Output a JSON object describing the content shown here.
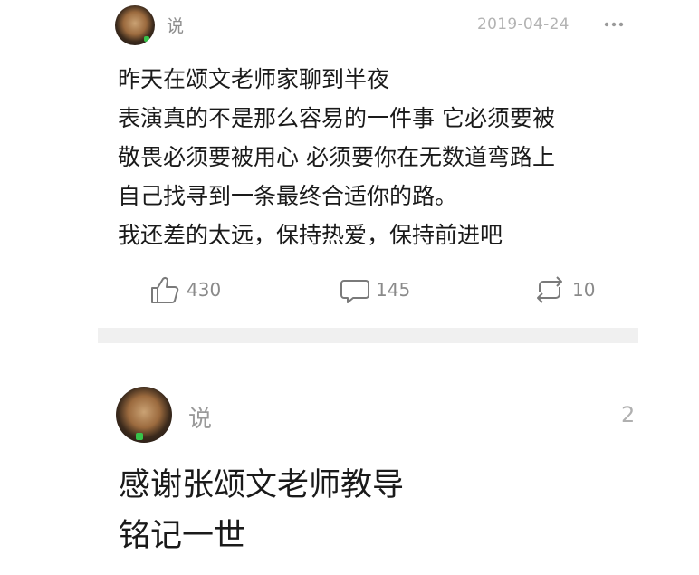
{
  "post1": {
    "author_suffix": "说",
    "date": "2019-04-24",
    "content": [
      "昨天在颂文老师家聊到半夜",
      "表演真的不是那么容易的一件事 它必须要被",
      "敬畏必须要被用心 必须要你在无数道弯路上",
      "自己找寻到一条最终合适你的路。",
      "我还差的太远，保持热爱，保持前进吧"
    ],
    "actions": {
      "likes": "430",
      "comments": "145",
      "reposts": "10"
    },
    "icons": {
      "like": "thumbs-up-icon",
      "comment": "comment-bubble-icon",
      "repost": "repost-icon",
      "more": "more-dots-icon"
    }
  },
  "post2": {
    "author_suffix": "说",
    "count": "2",
    "content": [
      "感谢张颂文老师教导",
      "铭记一世"
    ]
  },
  "colors": {
    "text_primary": "#1a1a1a",
    "text_secondary": "#8e8e8e",
    "date_gray": "#b3b3b3",
    "divider": "#f0f0f0",
    "badge_green": "#37c34a"
  }
}
